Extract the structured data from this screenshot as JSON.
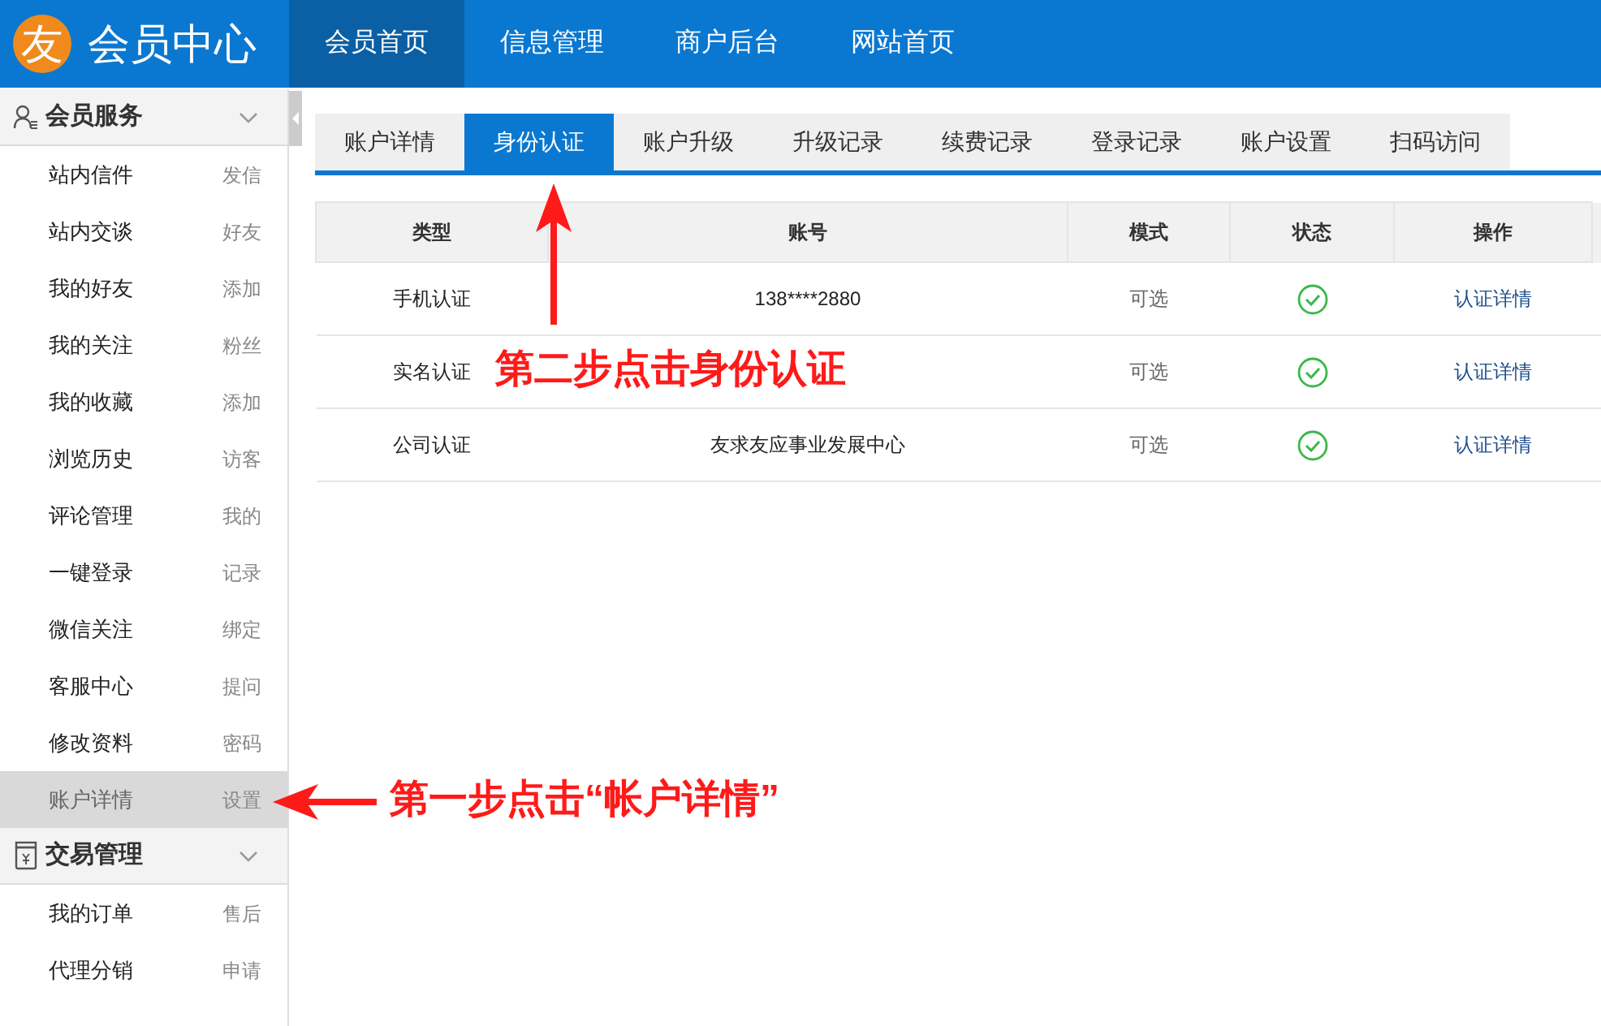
{
  "header": {
    "logo": "友",
    "title": "会员中心",
    "nav": [
      {
        "label": "会员首页",
        "selected": true
      },
      {
        "label": "信息管理",
        "selected": false
      },
      {
        "label": "商户后台",
        "selected": false
      },
      {
        "label": "网站首页",
        "selected": false
      }
    ]
  },
  "sidebar": {
    "sections": [
      {
        "kind": "member",
        "title": "会员服务",
        "items": [
          {
            "label": "站内信件",
            "action": "发信",
            "selected": false
          },
          {
            "label": "站内交谈",
            "action": "好友",
            "selected": false
          },
          {
            "label": "我的好友",
            "action": "添加",
            "selected": false
          },
          {
            "label": "我的关注",
            "action": "粉丝",
            "selected": false
          },
          {
            "label": "我的收藏",
            "action": "添加",
            "selected": false
          },
          {
            "label": "浏览历史",
            "action": "访客",
            "selected": false
          },
          {
            "label": "评论管理",
            "action": "我的",
            "selected": false
          },
          {
            "label": "一键登录",
            "action": "记录",
            "selected": false
          },
          {
            "label": "微信关注",
            "action": "绑定",
            "selected": false
          },
          {
            "label": "客服中心",
            "action": "提问",
            "selected": false
          },
          {
            "label": "修改资料",
            "action": "密码",
            "selected": false
          },
          {
            "label": "账户详情",
            "action": "设置",
            "selected": true
          }
        ]
      },
      {
        "kind": "trade",
        "title": "交易管理",
        "items": [
          {
            "label": "我的订单",
            "action": "售后",
            "selected": false
          },
          {
            "label": "代理分销",
            "action": "申请",
            "selected": false
          }
        ]
      }
    ]
  },
  "tabs": [
    {
      "label": "账户详情",
      "selected": false
    },
    {
      "label": "身份认证",
      "selected": true
    },
    {
      "label": "账户升级",
      "selected": false
    },
    {
      "label": "升级记录",
      "selected": false
    },
    {
      "label": "续费记录",
      "selected": false
    },
    {
      "label": "登录记录",
      "selected": false
    },
    {
      "label": "账户设置",
      "selected": false
    },
    {
      "label": "扫码访问",
      "selected": false
    }
  ],
  "table": {
    "columns": [
      "类型",
      "账号",
      "模式",
      "状态",
      "操作"
    ],
    "rows": [
      {
        "type": "手机认证",
        "account": "138****2880",
        "mode": "可选",
        "verified": true,
        "action": "认证详情"
      },
      {
        "type": "实名认证",
        "mode": "可选",
        "verified": true,
        "action": "认证详情"
      },
      {
        "type": "公司认证",
        "account": "友求友应事业发展中心",
        "mode": "可选",
        "verified": true,
        "action": "认证详情"
      }
    ]
  },
  "annotations": [
    {
      "kind": "up",
      "text": "第二步点击身份认证"
    },
    {
      "kind": "left",
      "text": "第一步点击“帐户详情”"
    }
  ]
}
